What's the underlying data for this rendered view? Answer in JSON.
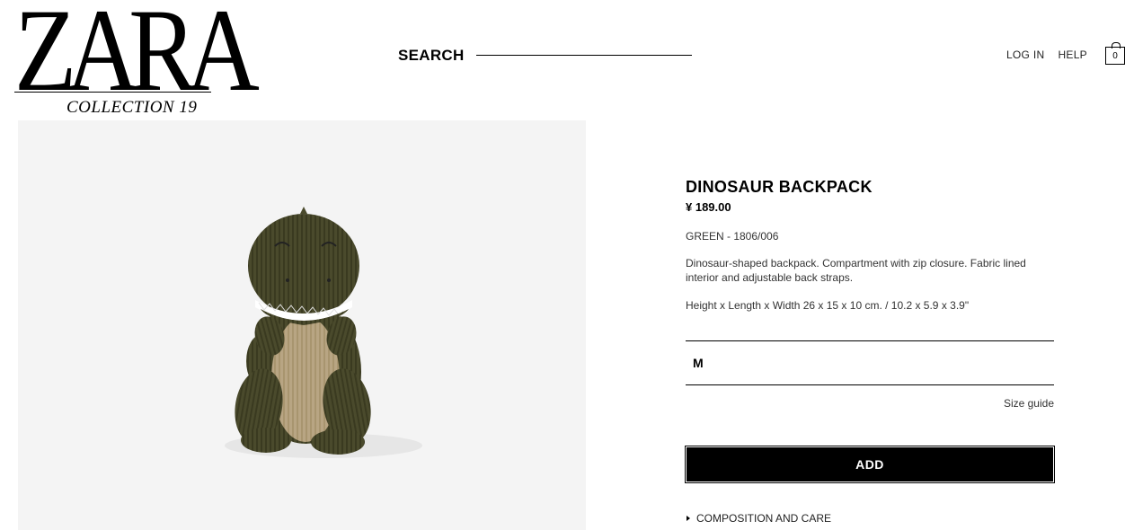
{
  "header": {
    "logo_text": "ZARA",
    "logo_subtitle": "COLLECTION 19",
    "search_label": "SEARCH",
    "login_label": "LOG IN",
    "help_label": "HELP",
    "bag_count": "0"
  },
  "product": {
    "image_icon": "dinosaur-plush-backpack",
    "name": "DINOSAUR BACKPACK",
    "price": "¥ 189.00",
    "color_ref": "GREEN - 1806/006",
    "description": "Dinosaur-shaped backpack. Compartment with zip closure. Fabric lined interior and adjustable back straps.",
    "dimensions": "Height x Length x Width 26 x 15 x 10 cm. / 10.2 x 5.9 x 3.9\"",
    "size_selected": "M",
    "size_guide_label": "Size guide",
    "add_label": "ADD",
    "composition_label": "COMPOSITION AND CARE"
  },
  "colors": {
    "background": "#ffffff",
    "image_bg": "#f4f4f4",
    "plush_dark": "#4a4a2c",
    "plush_belly": "#b8a583",
    "button_bg": "#000000",
    "button_text": "#ffffff"
  }
}
